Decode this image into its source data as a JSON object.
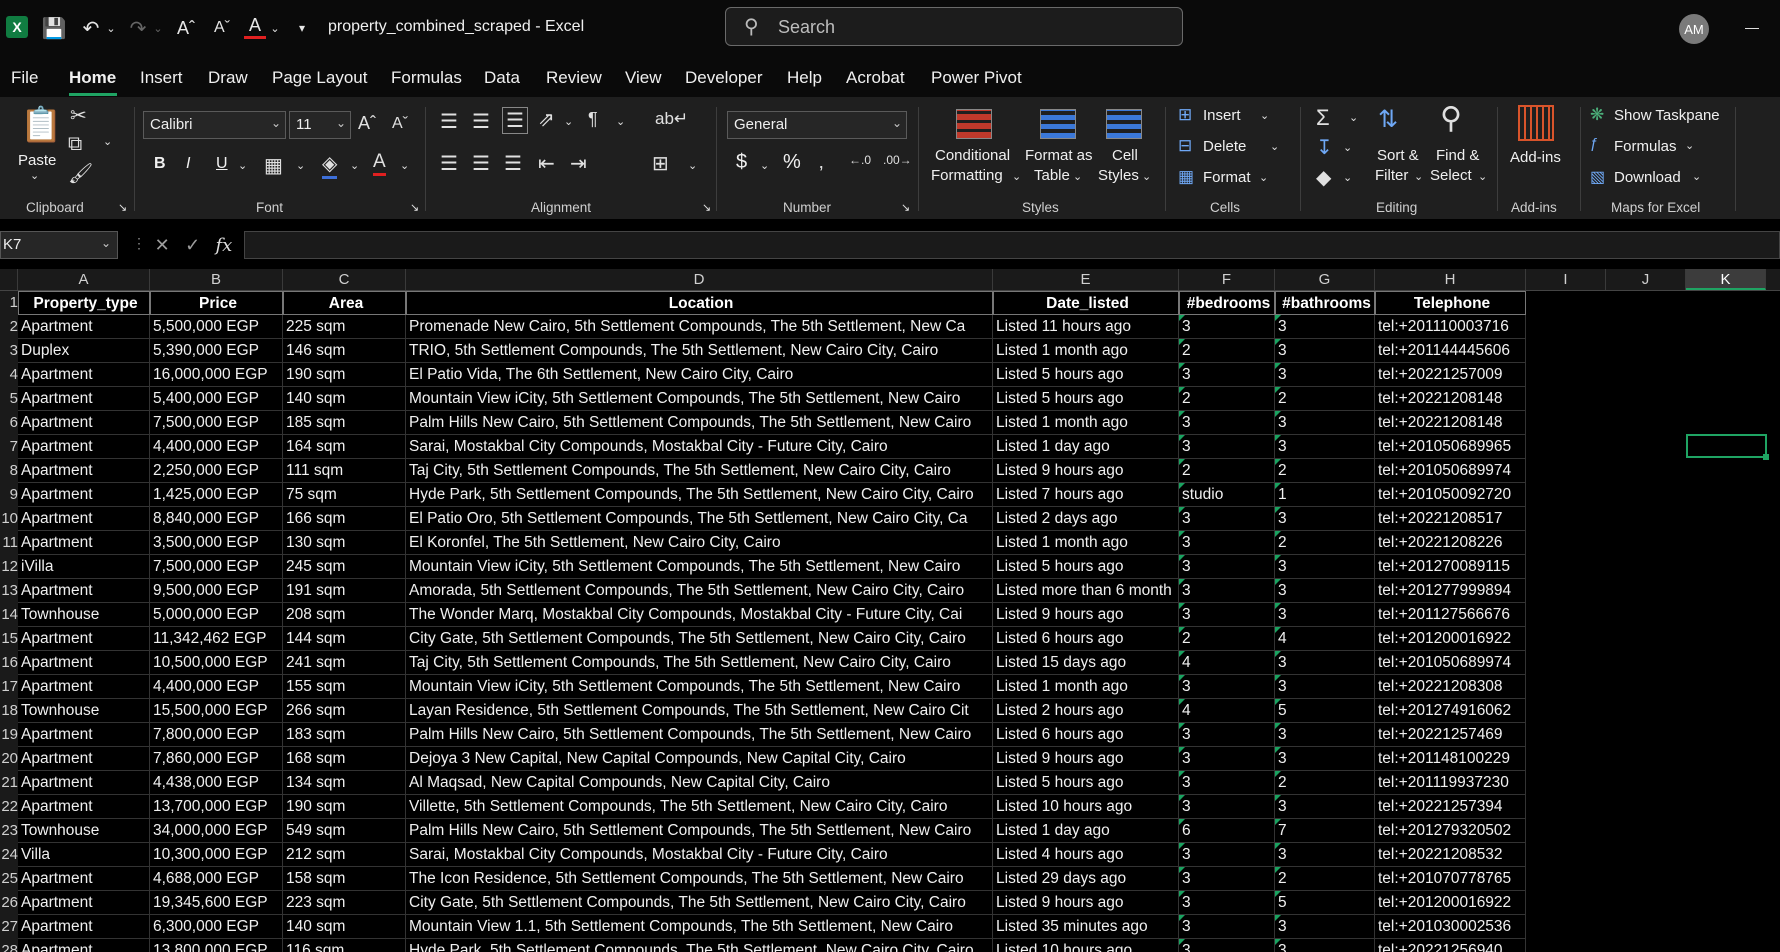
{
  "titlebar": {
    "doc_title": "property_combined_scraped  -  Excel",
    "search_placeholder": "Search",
    "avatar_initials": "AM"
  },
  "menu": [
    "File",
    "Home",
    "Insert",
    "Draw",
    "Page Layout",
    "Formulas",
    "Data",
    "Review",
    "View",
    "Developer",
    "Help",
    "Acrobat",
    "Power Pivot"
  ],
  "ribbon": {
    "clipboard": {
      "paste": "Paste",
      "label": "Clipboard"
    },
    "font": {
      "name": "Calibri",
      "size": "11",
      "label": "Font",
      "bold": "B",
      "italic": "I",
      "underline": "U"
    },
    "alignment": {
      "label": "Alignment"
    },
    "number": {
      "format": "General",
      "label": "Number",
      "currency": "$",
      "percent": "%"
    },
    "styles": {
      "conditional": "Conditional",
      "formatting": "Formatting",
      "format_as": "Format as",
      "table": "Table",
      "cell": "Cell",
      "cell_styles": "Styles",
      "label": "Styles"
    },
    "cells": {
      "insert": "Insert",
      "delete": "Delete",
      "format": "Format",
      "label": "Cells"
    },
    "editing": {
      "sort": "Sort &",
      "filter": "Filter",
      "find": "Find &",
      "select": "Select",
      "label": "Editing"
    },
    "addins": {
      "addins": "Add-ins",
      "label": "Add-ins"
    },
    "maps": {
      "taskpane": "Show Taskpane",
      "formulas": "Formulas",
      "download": "Download",
      "label": "Maps for Excel"
    }
  },
  "namebox": "K7",
  "columns": [
    "A",
    "B",
    "C",
    "D",
    "E",
    "F",
    "G",
    "H",
    "I",
    "J",
    "K"
  ],
  "headers": [
    "Property_type",
    "Price",
    "Area",
    "Location",
    "Date_listed",
    "#bedrooms",
    "#bathrooms",
    "Telephone"
  ],
  "rows": [
    [
      "Apartment",
      "5,500,000 EGP",
      "225 sqm",
      "Promenade New Cairo, 5th Settlement Compounds, The 5th Settlement, New Ca",
      "Listed 11 hours ago",
      "3",
      "3",
      "tel:+201110003716"
    ],
    [
      "Duplex",
      "5,390,000 EGP",
      "146 sqm",
      "TRIO, 5th Settlement Compounds, The 5th Settlement, New Cairo City, Cairo",
      "Listed 1 month ago",
      "2",
      "3",
      "tel:+201144445606"
    ],
    [
      "Apartment",
      "16,000,000 EGP",
      "190 sqm",
      "El Patio Vida, The 6th Settlement, New Cairo City, Cairo",
      "Listed 5 hours ago",
      "3",
      "3",
      "tel:+20221257009"
    ],
    [
      "Apartment",
      "5,400,000 EGP",
      "140 sqm",
      "Mountain View iCity, 5th Settlement Compounds, The 5th Settlement, New Cairo",
      "Listed 5 hours ago",
      "2",
      "2",
      "tel:+20221208148"
    ],
    [
      "Apartment",
      "7,500,000 EGP",
      "185 sqm",
      "Palm Hills New Cairo, 5th Settlement Compounds, The 5th Settlement, New Cairo",
      "Listed 1 month ago",
      "3",
      "3",
      "tel:+20221208148"
    ],
    [
      "Apartment",
      "4,400,000 EGP",
      "164 sqm",
      "Sarai, Mostakbal City Compounds, Mostakbal City - Future City, Cairo",
      "Listed 1 day ago",
      "3",
      "3",
      "tel:+201050689965"
    ],
    [
      "Apartment",
      "2,250,000 EGP",
      "111 sqm",
      "Taj City, 5th Settlement Compounds, The 5th Settlement, New Cairo City, Cairo",
      "Listed 9 hours ago",
      "2",
      "2",
      "tel:+201050689974"
    ],
    [
      "Apartment",
      "1,425,000 EGP",
      "75 sqm",
      "Hyde Park, 5th Settlement Compounds, The 5th Settlement, New Cairo City, Cairo",
      "Listed 7 hours ago",
      "studio",
      "1",
      "tel:+201050092720"
    ],
    [
      "Apartment",
      "8,840,000 EGP",
      "166 sqm",
      "El Patio Oro, 5th Settlement Compounds, The 5th Settlement, New Cairo City, Ca",
      "Listed 2 days ago",
      "3",
      "3",
      "tel:+20221208517"
    ],
    [
      "Apartment",
      "3,500,000 EGP",
      "130 sqm",
      "El Koronfel, The 5th Settlement, New Cairo City, Cairo",
      "Listed 1 month ago",
      "3",
      "2",
      "tel:+20221208226"
    ],
    [
      "iVilla",
      "7,500,000 EGP",
      "245 sqm",
      "Mountain View iCity, 5th Settlement Compounds, The 5th Settlement, New Cairo",
      "Listed 5 hours ago",
      "3",
      "3",
      "tel:+201270089115"
    ],
    [
      "Apartment",
      "9,500,000 EGP",
      "191 sqm",
      "Amorada, 5th Settlement Compounds, The 5th Settlement, New Cairo City, Cairo",
      "Listed more than 6 month",
      "3",
      "3",
      "tel:+201277999894"
    ],
    [
      "Townhouse",
      "5,000,000 EGP",
      "208 sqm",
      "The Wonder Marq, Mostakbal City Compounds, Mostakbal City - Future City, Cai",
      "Listed 9 hours ago",
      "3",
      "3",
      "tel:+201127566676"
    ],
    [
      "Apartment",
      "11,342,462 EGP",
      "144 sqm",
      "City Gate, 5th Settlement Compounds, The 5th Settlement, New Cairo City, Cairo",
      "Listed 6 hours ago",
      "2",
      "4",
      "tel:+201200016922"
    ],
    [
      "Apartment",
      "10,500,000 EGP",
      "241 sqm",
      "Taj City, 5th Settlement Compounds, The 5th Settlement, New Cairo City, Cairo",
      "Listed 15 days ago",
      "4",
      "3",
      "tel:+201050689974"
    ],
    [
      "Apartment",
      "4,400,000 EGP",
      "155 sqm",
      "Mountain View iCity, 5th Settlement Compounds, The 5th Settlement, New Cairo",
      "Listed 1 month ago",
      "3",
      "3",
      "tel:+20221208308"
    ],
    [
      "Townhouse",
      "15,500,000 EGP",
      "266 sqm",
      "Layan Residence, 5th Settlement Compounds, The 5th Settlement, New Cairo Cit",
      "Listed 2 hours ago",
      "4",
      "5",
      "tel:+201274916062"
    ],
    [
      "Apartment",
      "7,800,000 EGP",
      "183 sqm",
      "Palm Hills New Cairo, 5th Settlement Compounds, The 5th Settlement, New Cairo",
      "Listed 6 hours ago",
      "3",
      "3",
      "tel:+20221257469"
    ],
    [
      "Apartment",
      "7,860,000 EGP",
      "168 sqm",
      "Dejoya 3 New Capital, New Capital Compounds, New Capital City, Cairo",
      "Listed 9 hours ago",
      "3",
      "3",
      "tel:+201148100229"
    ],
    [
      "Apartment",
      "4,438,000 EGP",
      "134 sqm",
      "Al Maqsad, New Capital Compounds, New Capital City, Cairo",
      "Listed 5 hours ago",
      "3",
      "2",
      "tel:+201119937230"
    ],
    [
      "Apartment",
      "13,700,000 EGP",
      "190 sqm",
      "Villette, 5th Settlement Compounds, The 5th Settlement, New Cairo City, Cairo",
      "Listed 10 hours ago",
      "3",
      "3",
      "tel:+20221257394"
    ],
    [
      "Townhouse",
      "34,000,000 EGP",
      "549 sqm",
      "Palm Hills New Cairo, 5th Settlement Compounds, The 5th Settlement, New Cairo",
      "Listed 1 day ago",
      "6",
      "7",
      "tel:+201279320502"
    ],
    [
      "Villa",
      "10,300,000 EGP",
      "212 sqm",
      "Sarai, Mostakbal City Compounds, Mostakbal City - Future City, Cairo",
      "Listed 4 hours ago",
      "3",
      "3",
      "tel:+20221208532"
    ],
    [
      "Apartment",
      "4,688,000 EGP",
      "158 sqm",
      "The Icon Residence, 5th Settlement Compounds, The 5th Settlement, New Cairo",
      "Listed 29 days ago",
      "3",
      "2",
      "tel:+201070778765"
    ],
    [
      "Apartment",
      "19,345,600 EGP",
      "223 sqm",
      "City Gate, 5th Settlement Compounds, The 5th Settlement, New Cairo City, Cairo",
      "Listed 9 hours ago",
      "3",
      "5",
      "tel:+201200016922"
    ],
    [
      "Apartment",
      "6,300,000 EGP",
      "140 sqm",
      "Mountain View 1.1, 5th Settlement Compounds, The 5th Settlement, New Cairo",
      "Listed 35 minutes ago",
      "3",
      "3",
      "tel:+201030002536"
    ],
    [
      "Apartment",
      "13,800,000 EGP",
      "116 sqm",
      "Hyde Park, 5th Settlement Compounds, The 5th Settlement, New Cairo City, Cairo",
      "Listed 10 hours ago",
      "3",
      "3",
      "tel:+20221256940"
    ]
  ],
  "row_numbers": [
    "1",
    "2",
    "3",
    "4",
    "5",
    "6",
    "7",
    "8",
    "9",
    "10",
    "11",
    "12",
    "13",
    "14",
    "15",
    "16",
    "17",
    "18",
    "19",
    "20",
    "21",
    "22",
    "23",
    "24",
    "25",
    "26",
    "27",
    "28"
  ],
  "accent": "#1fa463"
}
